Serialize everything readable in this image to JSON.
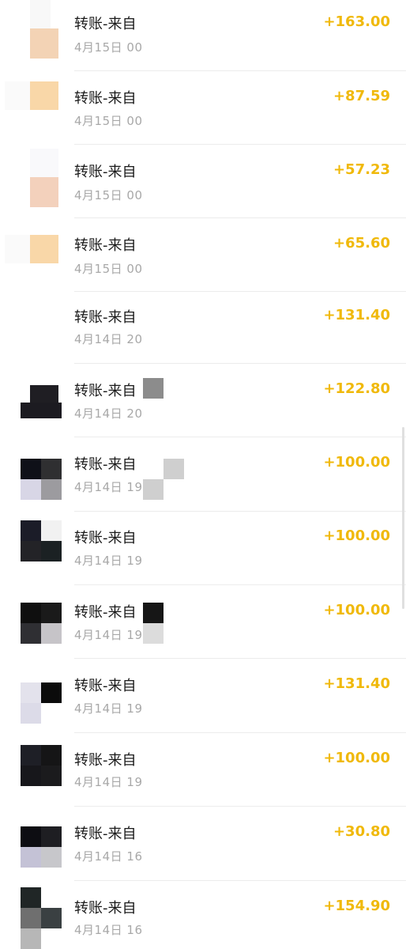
{
  "transactions": [
    {
      "title": "转账-来自",
      "date": "4月15日 00",
      "amount": "+163.00"
    },
    {
      "title": "转账-来自",
      "date": "4月15日 00",
      "amount": "+87.59"
    },
    {
      "title": "转账-来自",
      "date": "4月15日 00",
      "amount": "+57.23"
    },
    {
      "title": "转账-来自",
      "date": "4月15日 00",
      "amount": "+65.60"
    },
    {
      "title": "转账-来自",
      "date": "4月14日 20",
      "amount": "+131.40"
    },
    {
      "title": "转账-来自",
      "date": "4月14日 20",
      "amount": "+122.80"
    },
    {
      "title": "转账-来自",
      "date": "4月14日 19",
      "amount": "+100.00"
    },
    {
      "title": "转账-来自",
      "date": "4月14日 19",
      "amount": "+100.00"
    },
    {
      "title": "转账-来自",
      "date": "4月14日 19",
      "amount": "+100.00"
    },
    {
      "title": "转账-来自",
      "date": "4月14日 19",
      "amount": "+131.40"
    },
    {
      "title": "转账-来自",
      "date": "4月14日 19",
      "amount": "+100.00"
    },
    {
      "title": "转账-来自",
      "date": "4月14日 16",
      "amount": "+30.80"
    },
    {
      "title": "转账-来自",
      "date": "4月14日 16",
      "amount": "+154.90"
    }
  ],
  "colors": {
    "amount": "#f0b90b",
    "title": "#1a1a1a",
    "date": "#a8a8a8",
    "divider": "#ececec"
  }
}
